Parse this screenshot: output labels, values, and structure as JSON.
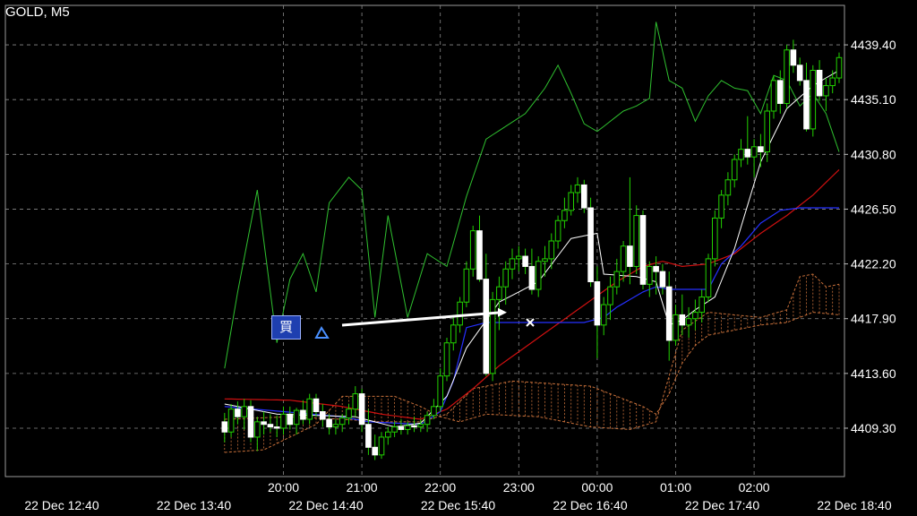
{
  "header": {
    "symbol": "GOLD, M5"
  },
  "trade": {
    "buy_label": "買",
    "entry_price": 4417.6,
    "exit_price": 4418.6
  },
  "colors": {
    "background": "#000000",
    "grid": "#8a8a8a",
    "bull": "#22d200",
    "bear": "#ffffff",
    "chikou": "#2fc02f",
    "tenkan": "#ffffff",
    "kijun": "#2530ff",
    "ma_red": "#d01010",
    "kumo": "#c8703a",
    "trade_line": "#ffffff",
    "buy_tag_bg": "#1e3fb0"
  },
  "chart_data": {
    "type": "candlestick",
    "title": "GOLD, M5",
    "ylim": [
      4405.5,
      4442.5
    ],
    "y_ticks": [
      "4439.40",
      "4435.10",
      "4430.80",
      "4426.50",
      "4422.20",
      "4417.90",
      "4413.60",
      "4409.30"
    ],
    "x_time_labels": [
      "20:00",
      "21:00",
      "22:00",
      "23:00",
      "00:00",
      "01:00",
      "02:00"
    ],
    "x_date_labels": [
      "22 Dec 12:40",
      "22 Dec 13:40",
      "22 Dec 14:40",
      "22 Dec 15:40",
      "22 Dec 16:40",
      "22 Dec 17:40",
      "22 Dec 18:40"
    ],
    "bars_per_hour": 12,
    "first_bar_time": "19:45",
    "grid": true,
    "candles": [
      [
        4409.8,
        4410.5,
        4408.2,
        4409.0
      ],
      [
        4409.0,
        4411.2,
        4408.6,
        4410.8
      ],
      [
        4410.8,
        4411.4,
        4409.6,
        4410.2
      ],
      [
        4410.2,
        4411.6,
        4409.2,
        4411.0
      ],
      [
        4411.0,
        4411.5,
        4408.2,
        4408.6
      ],
      [
        4408.6,
        4410.2,
        4407.5,
        4409.8
      ],
      [
        4409.8,
        4410.6,
        4408.8,
        4409.6
      ],
      [
        4409.6,
        4410.4,
        4409.0,
        4409.4
      ],
      [
        4409.4,
        4410.3,
        4408.6,
        4409.3
      ],
      [
        4409.3,
        4411.0,
        4408.8,
        4410.4
      ],
      [
        4410.4,
        4411.0,
        4409.2,
        4409.6
      ],
      [
        4409.6,
        4410.9,
        4408.8,
        4410.7
      ],
      [
        4410.7,
        4411.5,
        4409.6,
        4410.0
      ],
      [
        4410.0,
        4412.0,
        4409.6,
        4411.6
      ],
      [
        4411.6,
        4412.0,
        4410.2,
        4410.6
      ],
      [
        4410.6,
        4411.2,
        4409.4,
        4410.0
      ],
      [
        4410.0,
        4410.4,
        4408.8,
        4409.4
      ],
      [
        4409.4,
        4410.0,
        4408.8,
        4409.6
      ],
      [
        4409.6,
        4410.4,
        4409.0,
        4410.1
      ],
      [
        4410.1,
        4411.2,
        4409.6,
        4410.8
      ],
      [
        4410.8,
        4412.6,
        4410.2,
        4412.0
      ],
      [
        4412.0,
        4412.4,
        4409.0,
        4409.6
      ],
      [
        4409.6,
        4410.8,
        4407.2,
        4407.8
      ],
      [
        4407.8,
        4408.8,
        4406.8,
        4407.2
      ],
      [
        4407.2,
        4409.0,
        4406.9,
        4408.6
      ],
      [
        4408.6,
        4409.4,
        4408.0,
        4409.0
      ],
      [
        4409.0,
        4409.8,
        4408.6,
        4409.4
      ],
      [
        4409.4,
        4410.0,
        4408.8,
        4409.2
      ],
      [
        4409.2,
        4409.8,
        4408.8,
        4409.5
      ],
      [
        4409.5,
        4410.2,
        4409.0,
        4409.4
      ],
      [
        4409.4,
        4410.0,
        4409.0,
        4409.6
      ],
      [
        4409.6,
        4410.6,
        4409.0,
        4410.3
      ],
      [
        4410.3,
        4411.6,
        4410.0,
        4411.0
      ],
      [
        4411.0,
        4414.0,
        4410.6,
        4413.4
      ],
      [
        4413.4,
        4416.4,
        4413.0,
        4416.0
      ],
      [
        4416.0,
        4418.2,
        4415.4,
        4417.4
      ],
      [
        4417.4,
        4419.6,
        4416.8,
        4419.2
      ],
      [
        4419.2,
        4422.4,
        4418.8,
        4421.8
      ],
      [
        4421.8,
        4425.2,
        4421.2,
        4424.8
      ],
      [
        4424.8,
        4426.0,
        4420.8,
        4421.0
      ],
      [
        4421.0,
        4423.0,
        4413.4,
        4413.6
      ],
      [
        4413.6,
        4420.0,
        4413.0,
        4419.4
      ],
      [
        4419.4,
        4421.2,
        4417.0,
        4420.4
      ],
      [
        4420.4,
        4422.4,
        4419.0,
        4421.8
      ],
      [
        4421.8,
        4423.4,
        4421.0,
        4422.6
      ],
      [
        4422.6,
        4423.6,
        4421.6,
        4422.8
      ],
      [
        4422.8,
        4423.4,
        4421.4,
        4422.0
      ],
      [
        4422.0,
        4423.4,
        4419.8,
        4420.2
      ],
      [
        4420.2,
        4422.8,
        4419.6,
        4422.4
      ],
      [
        4422.4,
        4423.6,
        4421.2,
        4422.6
      ],
      [
        4422.6,
        4424.6,
        4421.8,
        4424.0
      ],
      [
        4424.0,
        4426.0,
        4423.4,
        4425.6
      ],
      [
        4425.6,
        4427.4,
        4425.0,
        4426.4
      ],
      [
        4426.4,
        4428.4,
        4426.0,
        4427.8
      ],
      [
        4427.8,
        4429.0,
        4427.0,
        4428.4
      ],
      [
        4428.4,
        4428.8,
        4426.2,
        4426.6
      ],
      [
        4426.6,
        4427.4,
        4420.4,
        4420.8
      ],
      [
        4420.8,
        4422.0,
        4414.8,
        4417.4
      ],
      [
        4417.4,
        4419.6,
        4416.6,
        4419.0
      ],
      [
        4419.0,
        4421.2,
        4417.8,
        4420.4
      ],
      [
        4420.4,
        4422.6,
        4419.8,
        4421.6
      ],
      [
        4421.6,
        4424.0,
        4420.8,
        4423.6
      ],
      [
        4423.6,
        4429.0,
        4420.6,
        4422.0
      ],
      [
        4422.0,
        4426.8,
        4421.4,
        4426.0
      ],
      [
        4426.0,
        4426.4,
        4420.2,
        4420.6
      ],
      [
        4420.6,
        4422.4,
        4419.6,
        4422.0
      ],
      [
        4422.0,
        4422.8,
        4419.8,
        4421.6
      ],
      [
        4421.6,
        4422.2,
        4419.8,
        4420.4
      ],
      [
        4420.4,
        4421.6,
        4414.6,
        4416.2
      ],
      [
        4416.2,
        4419.0,
        4415.8,
        4418.2
      ],
      [
        4418.2,
        4419.8,
        4416.6,
        4417.4
      ],
      [
        4417.4,
        4418.8,
        4416.4,
        4417.9
      ],
      [
        4417.9,
        4419.4,
        4417.0,
        4418.4
      ],
      [
        4418.4,
        4420.2,
        4417.6,
        4419.6
      ],
      [
        4419.6,
        4423.0,
        4419.2,
        4422.6
      ],
      [
        4422.6,
        4426.4,
        4422.0,
        4425.8
      ],
      [
        4425.8,
        4428.0,
        4425.0,
        4427.6
      ],
      [
        4427.6,
        4429.4,
        4426.8,
        4428.8
      ],
      [
        4428.8,
        4430.8,
        4428.2,
        4430.4
      ],
      [
        4430.4,
        4432.0,
        4429.8,
        4431.2
      ],
      [
        4431.2,
        4433.8,
        4430.0,
        4430.6
      ],
      [
        4430.6,
        4432.0,
        4429.0,
        4431.4
      ],
      [
        4431.4,
        4432.4,
        4429.8,
        4431.0
      ],
      [
        4431.0,
        4434.8,
        4430.2,
        4434.2
      ],
      [
        4434.2,
        4437.0,
        4433.6,
        4436.6
      ],
      [
        4436.6,
        4437.4,
        4434.0,
        4434.8
      ],
      [
        4434.8,
        4439.4,
        4434.4,
        4439.0
      ],
      [
        4439.0,
        4439.8,
        4437.2,
        4437.8
      ],
      [
        4437.8,
        4438.4,
        4436.2,
        4436.6
      ],
      [
        4436.6,
        4438.0,
        4432.6,
        4432.8
      ],
      [
        4432.8,
        4437.8,
        4432.2,
        4437.4
      ],
      [
        4437.4,
        4438.2,
        4435.0,
        4435.4
      ],
      [
        4435.4,
        4436.8,
        4434.2,
        4436.2
      ],
      [
        4436.2,
        4437.4,
        4435.6,
        4436.8
      ],
      [
        4436.8,
        4438.8,
        4436.4,
        4438.4
      ]
    ],
    "series": [
      {
        "kind": "tenkan",
        "anchor": [
          [
            0,
            4411.2
          ],
          [
            8,
            4410.4
          ],
          [
            20,
            4410.2
          ],
          [
            26,
            4409.4
          ],
          [
            30,
            4409.7
          ],
          [
            34,
            4411.8
          ],
          [
            37,
            4415.6
          ],
          [
            42,
            4419.2
          ],
          [
            48,
            4420.8
          ],
          [
            53,
            4424.2
          ],
          [
            57,
            4424.6
          ],
          [
            58,
            4421.4
          ],
          [
            63,
            4421.2
          ],
          [
            66,
            4420.8
          ],
          [
            68,
            4417.4
          ],
          [
            70,
            4417.8
          ],
          [
            72,
            4418.6
          ],
          [
            75,
            4419.6
          ],
          [
            78,
            4423.4
          ],
          [
            82,
            4430.2
          ],
          [
            86,
            4434.4
          ],
          [
            90,
            4436.2
          ],
          [
            94,
            4437.4
          ]
        ]
      },
      {
        "kind": "kijun",
        "anchor": [
          [
            0,
            4411.0
          ],
          [
            18,
            4410.2
          ],
          [
            22,
            4409.8
          ],
          [
            30,
            4409.6
          ],
          [
            33,
            4410.6
          ],
          [
            35,
            4413.0
          ],
          [
            37,
            4417.2
          ],
          [
            40,
            4417.6
          ],
          [
            55,
            4417.6
          ],
          [
            58,
            4418.0
          ],
          [
            60,
            4418.8
          ],
          [
            64,
            4420.0
          ],
          [
            66,
            4420.4
          ],
          [
            68,
            4420.2
          ],
          [
            71,
            4420.2
          ],
          [
            74,
            4420.2
          ],
          [
            76,
            4422.2
          ],
          [
            79,
            4423.6
          ],
          [
            82,
            4425.4
          ],
          [
            85,
            4426.4
          ],
          [
            88,
            4426.6
          ],
          [
            94,
            4426.6
          ]
        ]
      },
      {
        "kind": "ma_red",
        "anchor": [
          [
            0,
            4411.6
          ],
          [
            10,
            4411.5
          ],
          [
            18,
            4411.0
          ],
          [
            24,
            4410.4
          ],
          [
            30,
            4410.0
          ],
          [
            34,
            4410.8
          ],
          [
            38,
            4412.4
          ],
          [
            42,
            4414.2
          ],
          [
            48,
            4416.4
          ],
          [
            54,
            4418.6
          ],
          [
            60,
            4420.8
          ],
          [
            64,
            4422.0
          ],
          [
            67,
            4422.4
          ],
          [
            70,
            4422.0
          ],
          [
            74,
            4422.2
          ],
          [
            78,
            4423.0
          ],
          [
            82,
            4424.6
          ],
          [
            86,
            4426.0
          ],
          [
            90,
            4427.6
          ],
          [
            94,
            4429.6
          ]
        ]
      },
      {
        "kind": "chikou",
        "anchor": [
          [
            0,
            4414.0
          ],
          [
            2,
            4420.0
          ],
          [
            5,
            4428.0
          ],
          [
            8,
            4416.0
          ],
          [
            10,
            4421.0
          ],
          [
            12,
            4423.0
          ],
          [
            14,
            4420.0
          ],
          [
            16,
            4427.0
          ],
          [
            19,
            4429.0
          ],
          [
            21,
            4428.0
          ],
          [
            23,
            4418.0
          ],
          [
            25,
            4426.0
          ],
          [
            28,
            4418.0
          ],
          [
            31,
            4423.0
          ],
          [
            34,
            4422.0
          ],
          [
            37,
            4427.5
          ],
          [
            40,
            4432.0
          ],
          [
            43,
            4433.0
          ],
          [
            46,
            4434.0
          ],
          [
            49,
            4436.0
          ],
          [
            51,
            4437.8
          ],
          [
            53,
            4435.6
          ],
          [
            55,
            4433.2
          ],
          [
            57,
            4432.6
          ],
          [
            59,
            4433.4
          ],
          [
            61,
            4434.2
          ],
          [
            63,
            4434.6
          ],
          [
            65,
            4435.2
          ],
          [
            66,
            4441.2
          ],
          [
            68,
            4436.6
          ],
          [
            70,
            4436.0
          ],
          [
            72,
            4433.4
          ],
          [
            74,
            4435.4
          ],
          [
            76,
            4436.6
          ],
          [
            78,
            4436.0
          ],
          [
            80,
            4435.8
          ],
          [
            82,
            4434.0
          ],
          [
            84,
            4437.0
          ],
          [
            86,
            4436.6
          ],
          [
            88,
            4434.6
          ],
          [
            90,
            4435.6
          ],
          [
            92,
            4434.0
          ],
          [
            94,
            4431.0
          ]
        ]
      },
      {
        "kind": "span_a",
        "anchor": [
          [
            0,
            4410.0
          ],
          [
            10,
            4410.2
          ],
          [
            18,
            4410.0
          ],
          [
            24,
            4409.8
          ],
          [
            30,
            4409.8
          ],
          [
            34,
            4410.4
          ],
          [
            38,
            4412.4
          ],
          [
            44,
            4413.0
          ],
          [
            50,
            4412.8
          ],
          [
            56,
            4412.6
          ],
          [
            60,
            4411.8
          ],
          [
            64,
            4411.0
          ],
          [
            66,
            4410.4
          ],
          [
            68,
            4412.0
          ],
          [
            70,
            4414.4
          ],
          [
            72,
            4415.8
          ],
          [
            74,
            4416.6
          ],
          [
            78,
            4417.0
          ],
          [
            82,
            4417.4
          ],
          [
            86,
            4417.6
          ],
          [
            90,
            4418.4
          ],
          [
            94,
            4418.2
          ]
        ]
      },
      {
        "kind": "span_b",
        "anchor": [
          [
            0,
            4407.4
          ],
          [
            6,
            4407.6
          ],
          [
            14,
            4409.6
          ],
          [
            18,
            4411.8
          ],
          [
            22,
            4411.8
          ],
          [
            26,
            4411.8
          ],
          [
            30,
            4411.0
          ],
          [
            33,
            4410.2
          ],
          [
            36,
            4409.8
          ],
          [
            40,
            4410.4
          ],
          [
            48,
            4410.2
          ],
          [
            56,
            4409.4
          ],
          [
            62,
            4409.2
          ],
          [
            66,
            4409.8
          ],
          [
            70,
            4417.0
          ],
          [
            74,
            4418.4
          ],
          [
            78,
            4418.2
          ],
          [
            82,
            4418.0
          ],
          [
            86,
            4418.6
          ],
          [
            88,
            4421.2
          ],
          [
            90,
            4421.4
          ],
          [
            92,
            4420.4
          ],
          [
            94,
            4420.6
          ]
        ]
      }
    ]
  }
}
